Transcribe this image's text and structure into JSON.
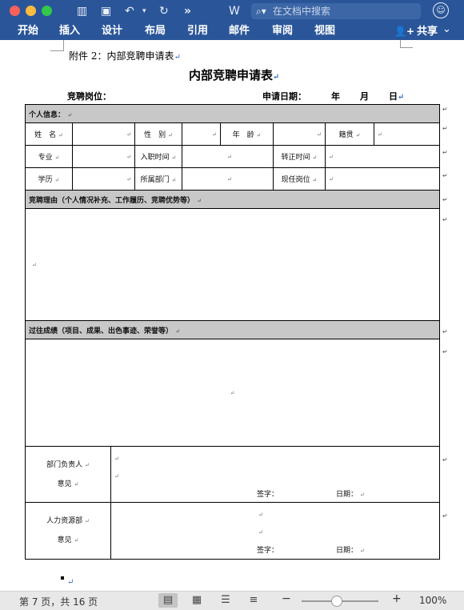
{
  "toolbar": {
    "search_placeholder": "在文档中搜索",
    "icons": [
      "sidebar-icon",
      "save-icon",
      "undo-icon",
      "redo-icon",
      "more-icon",
      "word-icon",
      "search-icon",
      "feedback-icon"
    ]
  },
  "ribbon": {
    "tabs": [
      "开始",
      "插入",
      "设计",
      "布局",
      "引用",
      "邮件",
      "审阅",
      "视图"
    ],
    "share_label": "共享"
  },
  "document": {
    "attachment_line": "附件 2：内部竞聘申请表",
    "title": "内部竞聘申请表",
    "position_label": "竞聘岗位：",
    "apply_date_label": "申请日期：",
    "date_year": "年",
    "date_month": "月",
    "date_day": "日",
    "para_mark": "↵",
    "form": {
      "section_personal": "个人信息：",
      "name": "姓　名",
      "gender": "性　别",
      "age": "年　龄",
      "native_place": "籍贯",
      "major": "专业",
      "join_date": "入职时间",
      "regular_date": "转正时间",
      "education": "学历",
      "department": "所属部门",
      "current_post": "现任岗位",
      "section_reason": "竞聘理由（个人情况补充、工作履历、竞聘优势等）",
      "section_achievements": "过往成绩（项目、成果、出色事迹、荣誉等）",
      "dept_head_line1": "部门负责人",
      "dept_head_line2": "意见",
      "hr_line1": "人力资源部",
      "hr_line2": "意见",
      "signature": "签字：",
      "date": "日期："
    }
  },
  "statusbar": {
    "page_info": "第 7 页，共 16 页",
    "zoom": "100%",
    "zoom_fraction": 0.45
  },
  "colors": {
    "titlebar": "#2a5699",
    "section_fill": "#c8c8c8"
  }
}
